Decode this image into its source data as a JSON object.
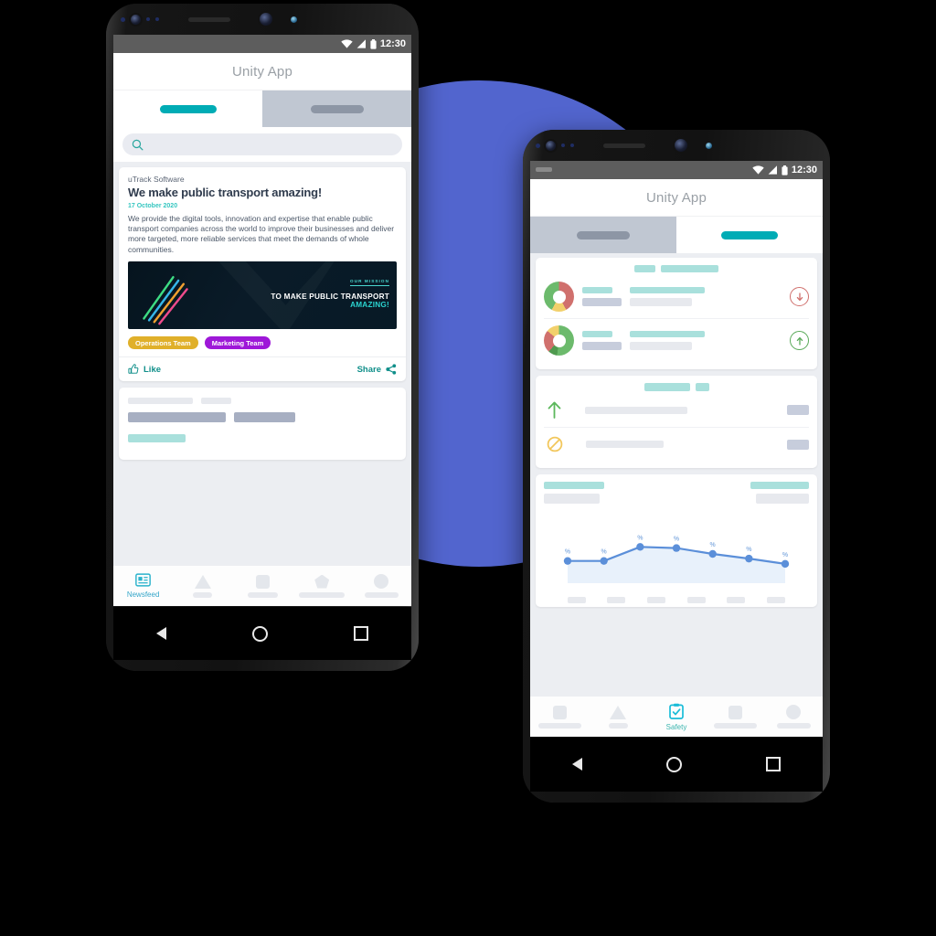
{
  "background": {
    "circle_color": "#5265CE",
    "page_background": "#000000"
  },
  "phone1": {
    "status": {
      "time": "12:30",
      "wifi_icon": "wifi-icon",
      "signal_icon": "signal-icon",
      "battery_icon": "battery-icon"
    },
    "app_title": "Unity App",
    "tabs": [
      {
        "name": "tab-active",
        "state": "active"
      },
      {
        "name": "tab-inactive",
        "state": "inactive"
      }
    ],
    "search": {
      "icon": "search-icon",
      "placeholder": ""
    },
    "article": {
      "source": "uTrack Software",
      "headline": "We make public transport amazing!",
      "date": "17 October 2020",
      "body": "We provide the digital tools, innovation and expertise that enable public transport companies across the world to improve their businesses and deliver more targeted, more reliable services that meet the demands of whole communities.",
      "banner": {
        "eyebrow": "OUR MISSION",
        "line1": "TO MAKE PUBLIC TRANSPORT",
        "line2": "AMAZING!",
        "accent_color": "#2bd4d0"
      },
      "tags": [
        {
          "label": "Operations Team",
          "color": "#e0b02a"
        },
        {
          "label": "Marketing Team",
          "color": "#9e18d8"
        }
      ],
      "actions": {
        "like_label": "Like",
        "like_icon": "thumbs-up-icon",
        "share_label": "Share",
        "share_icon": "share-icon"
      }
    },
    "bottom_nav": [
      {
        "label": "Newsfeed",
        "icon": "newsfeed-icon",
        "active": true
      },
      {
        "label": "",
        "icon": "triangle-placeholder-icon",
        "active": false
      },
      {
        "label": "",
        "icon": "square-placeholder-icon",
        "active": false
      },
      {
        "label": "",
        "icon": "pentagon-placeholder-icon",
        "active": false
      },
      {
        "label": "",
        "icon": "circle-placeholder-icon",
        "active": false
      }
    ],
    "system_nav": {
      "back": "back-triangle-icon",
      "home": "home-circle-icon",
      "recents": "recents-square-icon"
    }
  },
  "phone2": {
    "status": {
      "time": "12:30",
      "wifi_icon": "wifi-icon",
      "signal_icon": "signal-icon",
      "battery_icon": "battery-icon"
    },
    "app_title": "Unity App",
    "tabs": [
      {
        "name": "tab-inactive",
        "state": "inactive"
      },
      {
        "name": "tab-active",
        "state": "active"
      }
    ],
    "cards": [
      {
        "name": "donut-summary-card",
        "rows": [
          {
            "donut": {
              "segments": [
                {
                  "color": "#6cba6c",
                  "pct": 42
                },
                {
                  "color": "#f2d06b",
                  "pct": 16
                },
                {
                  "color": "#d0706d",
                  "pct": 42
                }
              ]
            },
            "trend_icon": "arrow-down-circle-icon",
            "trend_color": "#d0706d"
          },
          {
            "donut": {
              "segments": [
                {
                  "color": "#6cba6c",
                  "pct": 52
                },
                {
                  "color": "#4f9a4f",
                  "pct": 10
                },
                {
                  "color": "#d0706d",
                  "pct": 24
                },
                {
                  "color": "#f2d06b",
                  "pct": 14
                }
              ]
            },
            "trend_icon": "arrow-up-circle-icon",
            "trend_color": "#5aaa5a"
          }
        ]
      },
      {
        "name": "status-list-card",
        "rows": [
          {
            "icon": "arrow-up-icon",
            "icon_color": "#5cb85c"
          },
          {
            "icon": "no-entry-icon",
            "icon_color": "#f2c75c"
          }
        ]
      },
      {
        "name": "trend-chart-card"
      }
    ],
    "bottom_nav": [
      {
        "label": "",
        "icon": "square-placeholder-icon",
        "active": false
      },
      {
        "label": "",
        "icon": "triangle-placeholder-icon",
        "active": false
      },
      {
        "label": "Safety",
        "icon": "safety-clipboard-icon",
        "active": true
      },
      {
        "label": "",
        "icon": "square-placeholder-icon",
        "active": false
      },
      {
        "label": "",
        "icon": "circle-placeholder-icon",
        "active": false
      }
    ],
    "system_nav": {
      "back": "back-triangle-icon",
      "home": "home-circle-icon",
      "recents": "recents-square-icon"
    }
  },
  "chart_data": {
    "type": "area",
    "title": "",
    "xlabel": "",
    "ylabel": "",
    "categories": [
      "",
      "",
      "",
      "",
      "",
      "",
      ""
    ],
    "values": [
      38,
      38,
      62,
      60,
      50,
      42,
      33
    ],
    "point_labels": [
      "%",
      "%",
      "%",
      "%",
      "%",
      "%",
      "%"
    ],
    "line_color": "#5b8fd9",
    "fill_color": "#e8f1fb",
    "marker_color": "#5b8fd9",
    "grid": false,
    "legend": "none",
    "ylim": [
      0,
      100
    ],
    "xtick_count": 6
  }
}
